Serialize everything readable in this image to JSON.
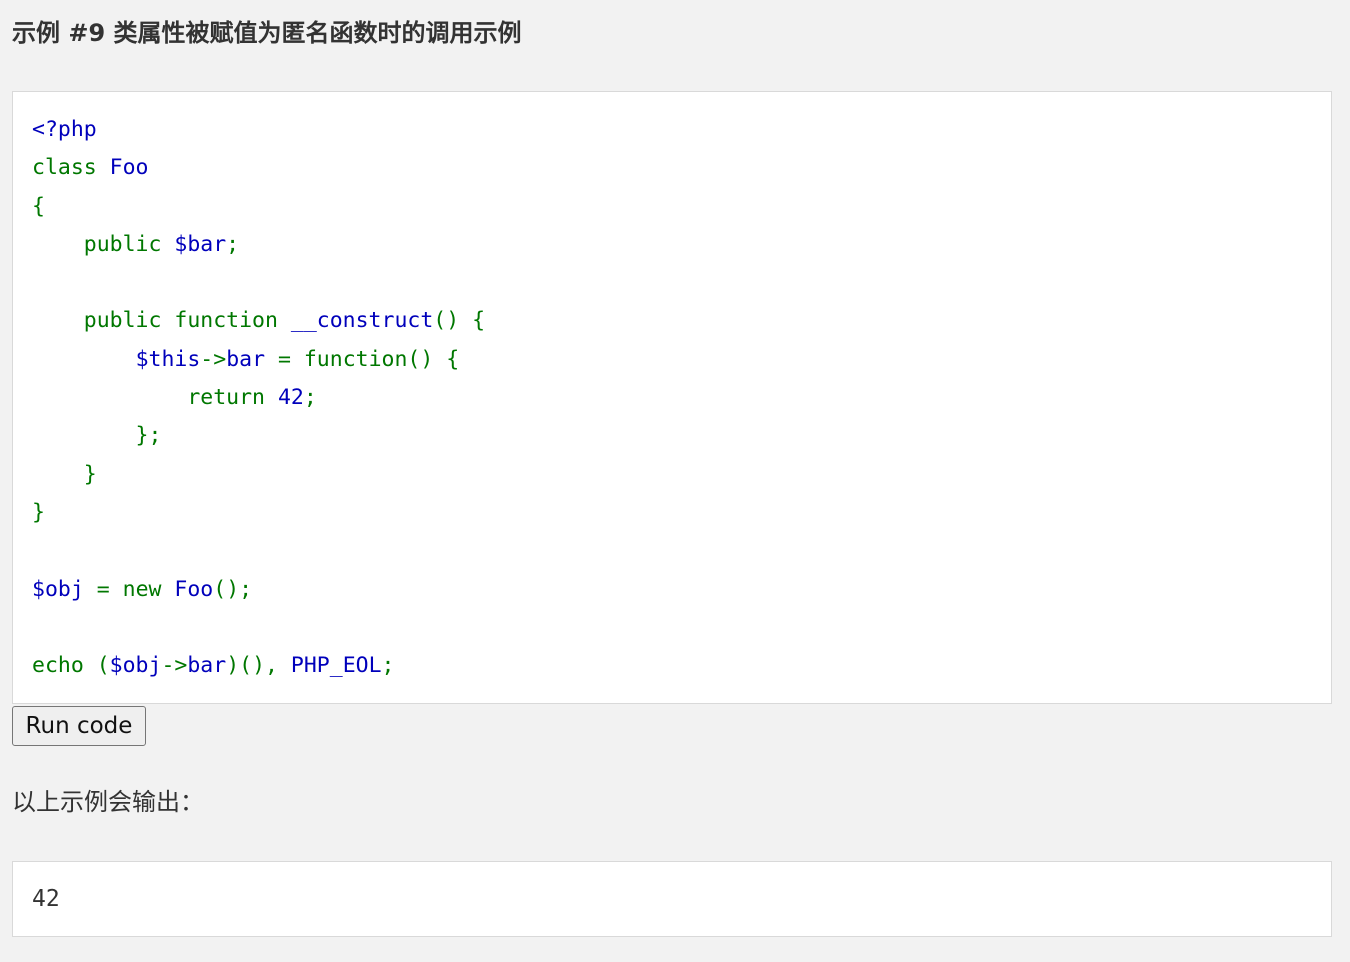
{
  "example": {
    "title": "示例 #9 类属性被赋值为匿名函数时的调用示例"
  },
  "code": {
    "lines": [
      [
        {
          "t": "<?php",
          "c": "id"
        }
      ],
      [
        {
          "t": "class ",
          "c": "kw"
        },
        {
          "t": "Foo",
          "c": "id"
        }
      ],
      [
        {
          "t": "{",
          "c": "kw"
        }
      ],
      [
        {
          "t": "    public ",
          "c": "kw"
        },
        {
          "t": "$bar",
          "c": "id"
        },
        {
          "t": ";",
          "c": "kw"
        }
      ],
      [],
      [
        {
          "t": "    public function ",
          "c": "kw"
        },
        {
          "t": "__construct",
          "c": "id"
        },
        {
          "t": "() {",
          "c": "kw"
        }
      ],
      [
        {
          "t": "        ",
          "c": "kw"
        },
        {
          "t": "$this",
          "c": "id"
        },
        {
          "t": "->",
          "c": "kw"
        },
        {
          "t": "bar ",
          "c": "id"
        },
        {
          "t": "= function() {",
          "c": "kw"
        }
      ],
      [
        {
          "t": "            return ",
          "c": "kw"
        },
        {
          "t": "42",
          "c": "num"
        },
        {
          "t": ";",
          "c": "kw"
        }
      ],
      [
        {
          "t": "        };",
          "c": "kw"
        }
      ],
      [
        {
          "t": "    }",
          "c": "kw"
        }
      ],
      [
        {
          "t": "}",
          "c": "kw"
        }
      ],
      [],
      [
        {
          "t": "$obj ",
          "c": "id"
        },
        {
          "t": "= new ",
          "c": "kw"
        },
        {
          "t": "Foo",
          "c": "id"
        },
        {
          "t": "();",
          "c": "kw"
        }
      ],
      [],
      [
        {
          "t": "echo (",
          "c": "kw"
        },
        {
          "t": "$obj",
          "c": "id"
        },
        {
          "t": "->",
          "c": "kw"
        },
        {
          "t": "bar",
          "c": "id"
        },
        {
          "t": ")(), ",
          "c": "kw"
        },
        {
          "t": "PHP_EOL",
          "c": "id"
        },
        {
          "t": ";",
          "c": "kw"
        }
      ]
    ],
    "colors": {
      "keyword": "#007700",
      "identifier": "#0000bb",
      "number": "#0000bb"
    }
  },
  "run_button": {
    "label": "Run code"
  },
  "output": {
    "label": "以上示例会输出：",
    "value": "42"
  }
}
